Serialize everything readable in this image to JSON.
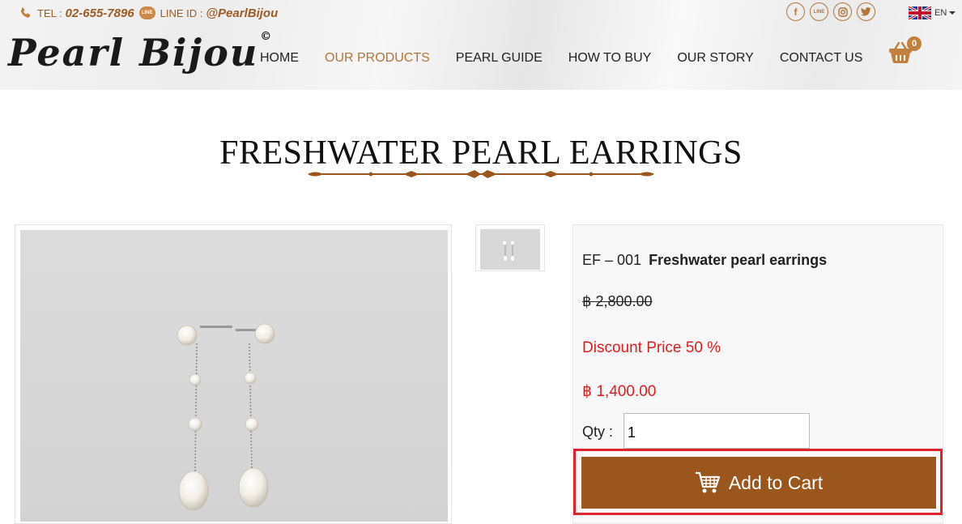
{
  "topbar": {
    "tel_label": "TEL :",
    "tel_value": "02-655-7896",
    "line_badge": "LINE",
    "line_label": "LINE ID :",
    "line_value": "@PearlBijou"
  },
  "socials": [
    {
      "icon": "facebook-icon",
      "glyph": "f"
    },
    {
      "icon": "line-icon",
      "glyph": "LINE"
    },
    {
      "icon": "instagram-icon",
      "glyph": ""
    },
    {
      "icon": "twitter-icon",
      "glyph": ""
    }
  ],
  "language": {
    "current": "EN",
    "flag_icon": "uk-flag-icon",
    "caret_icon": "caret-down-icon"
  },
  "logo": {
    "text": "Pearl Bijou",
    "mark": "©"
  },
  "nav": {
    "items": [
      {
        "label": "HOME",
        "active": false
      },
      {
        "label": "OUR PRODUCTS",
        "active": true
      },
      {
        "label": "PEARL GUIDE",
        "active": false
      },
      {
        "label": "HOW TO BUY",
        "active": false
      },
      {
        "label": "OUR STORY",
        "active": false
      },
      {
        "label": "CONTACT US",
        "active": false
      }
    ]
  },
  "cart": {
    "count": "0",
    "icon": "basket-icon"
  },
  "page": {
    "title": "FRESHWATER PEARL EARRINGS"
  },
  "product": {
    "code": "EF – 001",
    "name": "Freshwater pearl earrings",
    "old_price": "฿ 2,800.00",
    "discount": "Discount Price 50 %",
    "price": "฿ 1,400.00",
    "qty_label": "Qty :",
    "qty_value": "1",
    "add_to_cart": "Add to Cart"
  },
  "colors": {
    "accent": "#b0753a",
    "button": "#9a561c",
    "sale": "#e01b1b",
    "highlight_outline": "#e0242e"
  }
}
